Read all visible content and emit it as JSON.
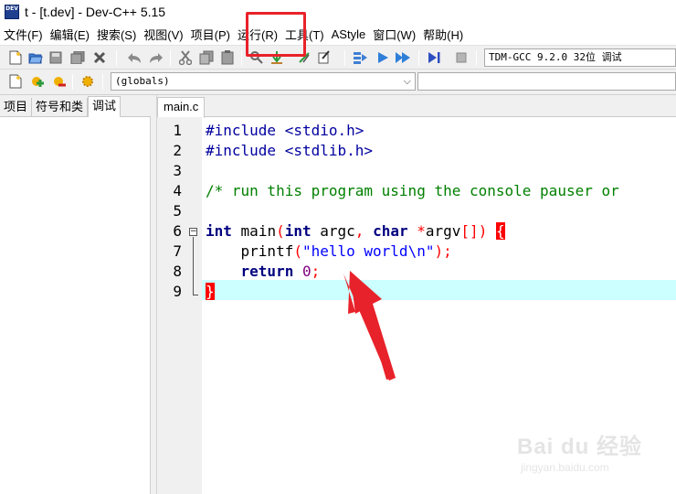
{
  "window": {
    "title": "t - [t.dev] - Dev-C++ 5.15",
    "icon_name": "devcpp-app-icon",
    "icon_text": "DEV"
  },
  "menu": {
    "items": [
      {
        "label": "文件(F)"
      },
      {
        "label": "编辑(E)"
      },
      {
        "label": "搜索(S)"
      },
      {
        "label": "视图(V)"
      },
      {
        "label": "项目(P)"
      },
      {
        "label": "运行(R)"
      },
      {
        "label": "工具(T)"
      },
      {
        "label": "AStyle"
      },
      {
        "label": "窗口(W)"
      },
      {
        "label": "帮助(H)"
      }
    ]
  },
  "toolbar": {
    "compiler_select": "TDM-GCC 9.2.0 32位 调试",
    "scope_select": "(globals)",
    "icons": [
      "new-file-icon",
      "open-icon",
      "save-icon",
      "save-all-icon",
      "close-icon",
      "undo-icon",
      "redo-icon",
      "cut-icon",
      "copy-icon",
      "paste-icon",
      "search-icon",
      "replace-icon",
      "goto-icon",
      "bookmark-icon",
      "compile-icon",
      "run-icon",
      "compile-run-icon",
      "debug-icon",
      "stop-icon"
    ]
  },
  "left_panel": {
    "tabs": [
      {
        "label": "项目"
      },
      {
        "label": "符号和类"
      },
      {
        "label": "调试"
      }
    ],
    "active_tab": "调试"
  },
  "editor": {
    "file_tab": "main.c",
    "line_numbers": [
      "1",
      "2",
      "3",
      "4",
      "5",
      "6",
      "7",
      "8",
      "9"
    ],
    "lines": {
      "l1": {
        "pre": "#include <stdio.h>"
      },
      "l2": {
        "pre": "#include <stdlib.h>"
      },
      "l3": {},
      "l4": {
        "comment": "/* run this program using the console pauser or"
      },
      "l5": {},
      "l6": {
        "kw1": "int",
        "sp1": " ",
        "fn": "main",
        "p1": "(",
        "kw2": "int",
        "t1": " argc",
        "c1": ",",
        "sp2": " ",
        "kw3": "char",
        "sp3": " ",
        "star": "*",
        "t2": "argv",
        "br": "[])",
        "sp4": " ",
        "brace": "{"
      },
      "l7": {
        "indent": "    ",
        "fn": "printf",
        "p1": "(",
        "str": "\"hello world\\n\"",
        "p2": ");"
      },
      "l8": {
        "indent": "    ",
        "kw": "return",
        "sp": " ",
        "num": "0",
        "semi": ";"
      },
      "l9": {
        "brace": "}"
      }
    }
  },
  "watermark": {
    "brand": "Bai du 经验",
    "sub": "jingyan.baidu.com"
  },
  "colors": {
    "annotation_red": "#e8222a",
    "current_line": "#ccffff",
    "keyword": "#000080",
    "preprocessor": "#0000a0",
    "comment": "#008000",
    "string": "#0000ff",
    "number": "#800080",
    "symbol": "#ff0000"
  }
}
